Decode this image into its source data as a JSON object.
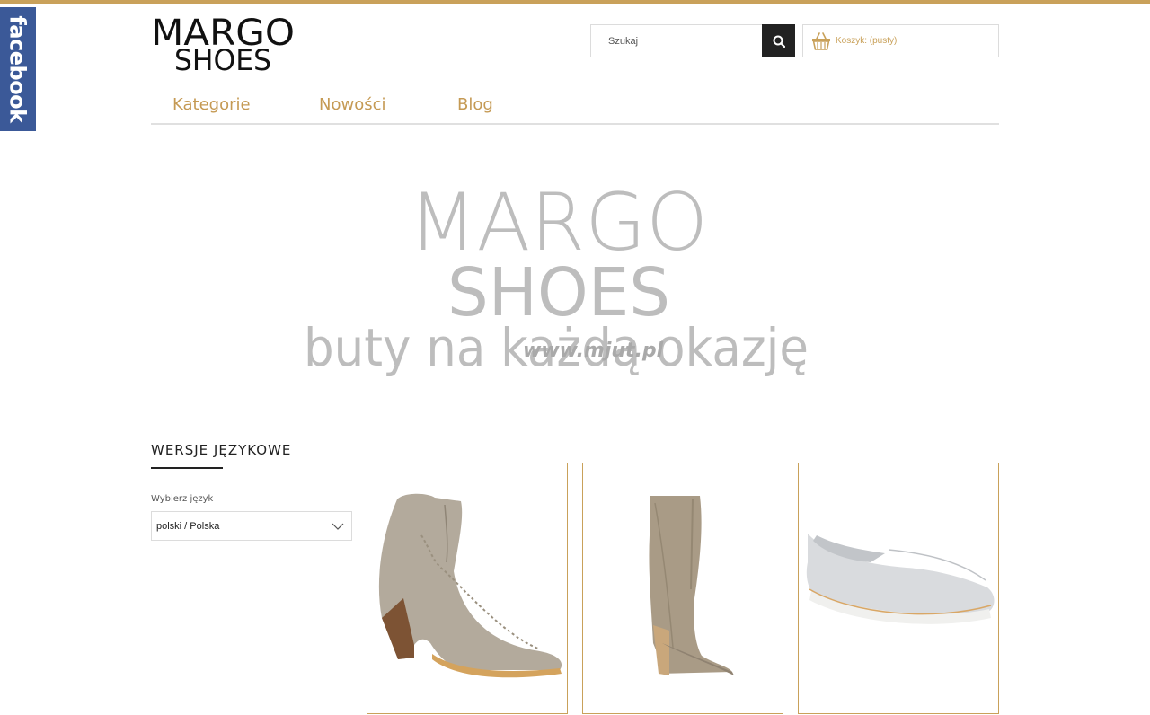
{
  "facebook": {
    "label": "facebook"
  },
  "logo": {
    "line1": "MARGO",
    "line2": "SHOES"
  },
  "search": {
    "placeholder": "Szukaj"
  },
  "cart": {
    "label": "Koszyk: (pusty)"
  },
  "nav": {
    "items": [
      "Kategorie",
      "Nowości",
      "Blog"
    ]
  },
  "banner": {
    "line1": "MARGO",
    "line2": "SHOES",
    "tagline": "buty na każdą okazję",
    "watermark": "www.mjut.pl"
  },
  "language_section": {
    "title": "WERSJE JĘZYKOWE",
    "label": "Wybierz język",
    "selected": "polski / Polska"
  },
  "products": [
    {
      "name": "ankle-boot"
    },
    {
      "name": "knee-boot"
    },
    {
      "name": "slip-on"
    }
  ],
  "colors": {
    "accent": "#c9a15a",
    "nav_text": "#c59a54",
    "facebook": "#3b5998",
    "dark": "#222222"
  }
}
